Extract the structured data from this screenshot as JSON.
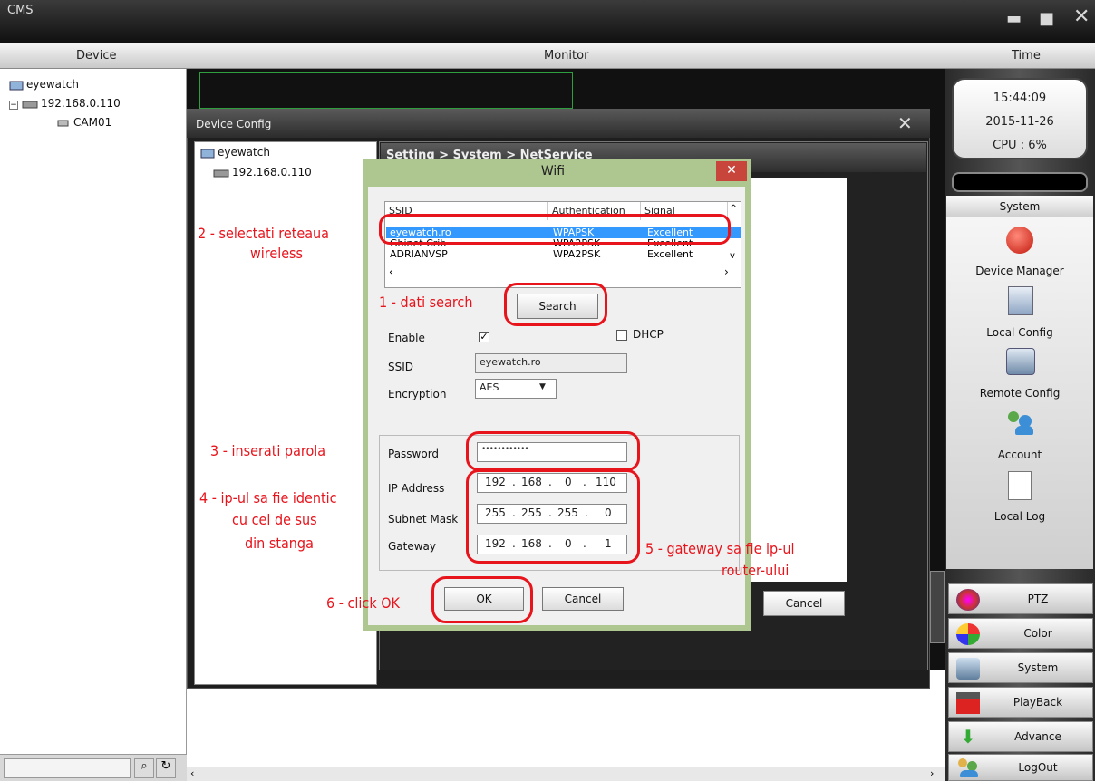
{
  "window": {
    "title": "CMS"
  },
  "header": {
    "device": "Device",
    "monitor": "Monitor",
    "time": "Time"
  },
  "tree": {
    "root": "eyewatch",
    "device": "192.168.0.110",
    "camera": "CAM01"
  },
  "clock": {
    "time": "15:44:09",
    "date": "2015-11-26",
    "cpu": "CPU : 6%"
  },
  "system_menu": {
    "title": "System",
    "items": [
      "Device Manager",
      "Local Config",
      "Remote Config",
      "Account",
      "Local Log"
    ]
  },
  "bottom_buttons": [
    "PTZ",
    "Color",
    "System",
    "PlayBack",
    "Advance",
    "LogOut"
  ],
  "device_config": {
    "title": "Device Config",
    "tree_root": "eyewatch",
    "tree_device": "192.168.0.110",
    "breadcrumb": "Setting > System > NetService",
    "cancel": "Cancel"
  },
  "wifi": {
    "title": "Wifi",
    "columns": [
      "SSID",
      "Authentication",
      "Signal"
    ],
    "networks": [
      {
        "ssid": "eyewatch.ro",
        "auth": "WPAPSK",
        "signal": "Excellent",
        "selected": true
      },
      {
        "ssid": "Ghinet Crib",
        "auth": "WPA2PSK",
        "signal": "Excellent",
        "selected": false
      },
      {
        "ssid": "ADRIANVSP",
        "auth": "WPA2PSK",
        "signal": "Excellent",
        "selected": false
      }
    ],
    "search": "Search",
    "enable_label": "Enable",
    "enable_checked": "✓",
    "dhcp_label": "DHCP",
    "ssid_label": "SSID",
    "ssid_value": "eyewatch.ro",
    "encryption_label": "Encryption",
    "encryption_value": "AES",
    "password_label": "Password",
    "password_value": "••••••••••••",
    "ip_label": "IP Address",
    "ip": [
      "192",
      "168",
      "0",
      "110"
    ],
    "mask_label": "Subnet Mask",
    "mask": [
      "255",
      "255",
      "255",
      "0"
    ],
    "gateway_label": "Gateway",
    "gateway": [
      "192",
      "168",
      "0",
      "1"
    ],
    "ok": "OK",
    "cancel": "Cancel"
  },
  "annotations": {
    "a1": "1 - dati search",
    "a2_l1": "2 - selectati reteaua",
    "a2_l2": "wireless",
    "a3": "3 - inserati parola",
    "a4_l1": "4 - ip-ul sa fie identic",
    "a4_l2": "cu cel de sus",
    "a4_l3": "din stanga",
    "a5_l1": "5 - gateway sa fie ip-ul",
    "a5_l2": "router-ului",
    "a6": "6 - click OK"
  },
  "colors": {
    "annotation": "#e8141c",
    "selection": "#3399ff",
    "dialog_frame": "#aec790"
  }
}
